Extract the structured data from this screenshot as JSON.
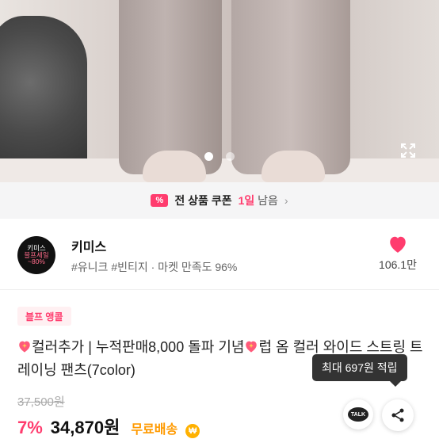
{
  "hero": {
    "slide_count": 2,
    "active_slide": 1,
    "expand_icon": "expand-icon"
  },
  "coupon": {
    "icon_glyph": "%",
    "label": "전 상품 쿠폰",
    "remaining_red": "1일",
    "remaining_suffix": "남음",
    "chevron": "›"
  },
  "seller": {
    "logo_lines": [
      "키미스",
      "블프세일",
      "~80%"
    ],
    "name": "키미스",
    "tags": "#유니크 #빈티지 · 마켓 만족도 96%",
    "like_count": "106.1만",
    "like_color": "#ff3c6e"
  },
  "product": {
    "badge": "블프 앵콜",
    "title_part1": "컬러추가 | 누적판매8,000 돌파 기념",
    "title_part2": "럽 옴 컬러 와이드 스트링 트레이닝 팬츠(7color)",
    "original_price": "37,500원",
    "discount": "7%",
    "price": "34,870원",
    "shipping": "무료배송",
    "shipping_icon": "₩"
  },
  "tooltip": {
    "text": "최대 697원 적립"
  },
  "actions": {
    "talk_label": "TALK",
    "share_icon": "share-icon"
  },
  "colors": {
    "accent": "#ff3c6e",
    "shipping": "#ff9a00"
  }
}
